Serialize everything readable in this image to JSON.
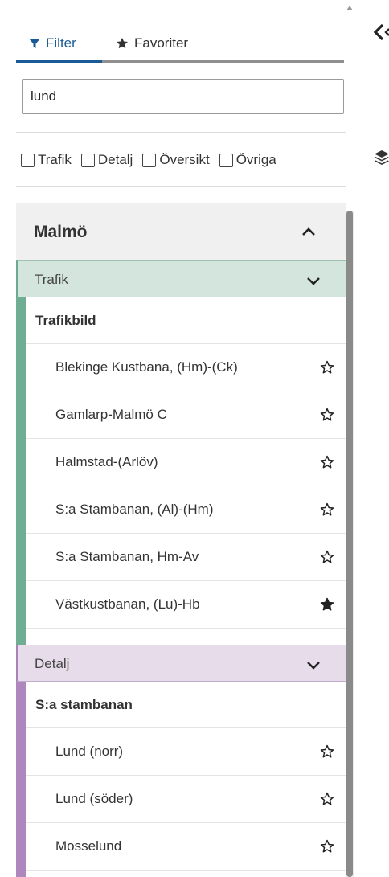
{
  "tabs": {
    "filter": "Filter",
    "favorites": "Favoriter"
  },
  "search": {
    "value": "lund"
  },
  "checkboxes": [
    "Trafik",
    "Detalj",
    "Översikt",
    "Övriga"
  ],
  "city": {
    "name": "Malmö"
  },
  "groups": {
    "trafik": {
      "label": "Trafik",
      "subheading": "Trafikbild",
      "items": [
        {
          "label": "Blekinge Kustbana, (Hm)-(Ck)",
          "favorite": false
        },
        {
          "label": "Gamlarp-Malmö C",
          "favorite": false
        },
        {
          "label": "Halmstad-(Arlöv)",
          "favorite": false
        },
        {
          "label": "S:a Stambanan, (Al)-(Hm)",
          "favorite": false
        },
        {
          "label": "S:a Stambanan, Hm-Av",
          "favorite": false
        },
        {
          "label": "Västkustbanan, (Lu)-Hb",
          "favorite": true
        }
      ]
    },
    "detalj": {
      "label": "Detalj",
      "subheading": "S:a stambanan",
      "items": [
        {
          "label": "Lund (norr)",
          "favorite": false
        },
        {
          "label": "Lund (söder)",
          "favorite": false
        },
        {
          "label": "Mosselund",
          "favorite": false
        }
      ]
    }
  },
  "icons": {
    "filter_tab": "funnel-icon",
    "favorites_tab": "star-icon",
    "collapse_panel": "chevron-left-icon",
    "layers": "layers-icon"
  },
  "colors": {
    "accent": "#1a5a96",
    "trafik": "#6fae93",
    "detalj": "#ae87bd"
  }
}
